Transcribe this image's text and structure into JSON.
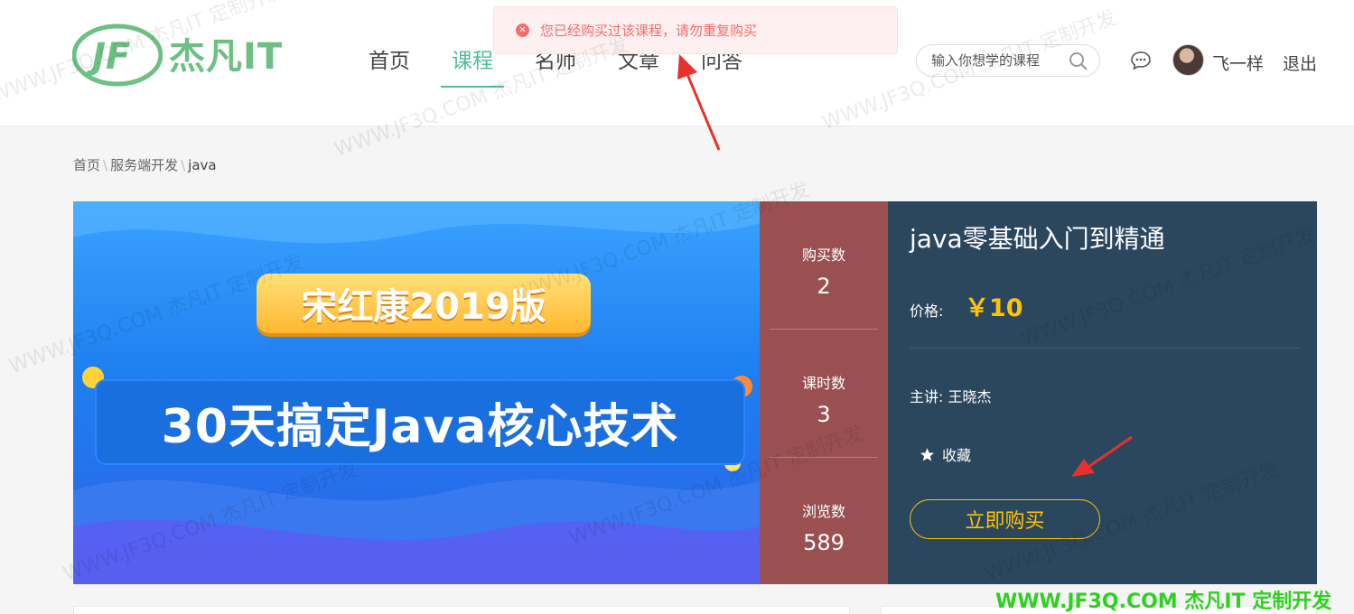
{
  "brand": {
    "name": "杰凡IT",
    "logo_mark": "JF",
    "color": "#6cc083"
  },
  "nav": {
    "items": [
      {
        "label": "首页",
        "active": false
      },
      {
        "label": "课程",
        "active": true
      },
      {
        "label": "名师",
        "active": false
      },
      {
        "label": "文章",
        "active": false
      },
      {
        "label": "问答",
        "active": false
      }
    ],
    "active_color": "#4fbe9b"
  },
  "toast": {
    "text": "您已经购买过该课程，请勿重复购买",
    "type": "error",
    "icon": "close-circle-icon"
  },
  "search": {
    "placeholder": "输入你想学的课程",
    "icon": "search-icon"
  },
  "user": {
    "name": "飞一样",
    "logout_label": "退出",
    "message_icon": "chat-bubble-icon"
  },
  "breadcrumb": {
    "items": [
      "首页",
      "服务端开发",
      "java"
    ],
    "separator": "\\"
  },
  "banner": {
    "tag": "宋红康2019版",
    "headline": "30天搞定Java核心技术"
  },
  "stats": [
    {
      "label": "购买数",
      "value": "2"
    },
    {
      "label": "课时数",
      "value": "3"
    },
    {
      "label": "浏览数",
      "value": "589"
    }
  ],
  "course": {
    "title": "java零基础入门到精通",
    "price_label": "价格:",
    "price": "￥10",
    "teacher_label": "主讲:",
    "teacher": "王晓杰",
    "favorite_label": "收藏",
    "buy_label": "立即购买"
  },
  "colors": {
    "stats_bg": "#9a5050",
    "info_bg": "#2b475e",
    "price": "#ffc400",
    "toast_text": "#f56c6c",
    "annotation_arrow": "#e8312a"
  },
  "watermark": {
    "repeated": "WWW.JF3Q.COM 杰凡IT 定制开发",
    "footer": "WWW.JF3Q.COM 杰凡IT  定制开发"
  }
}
